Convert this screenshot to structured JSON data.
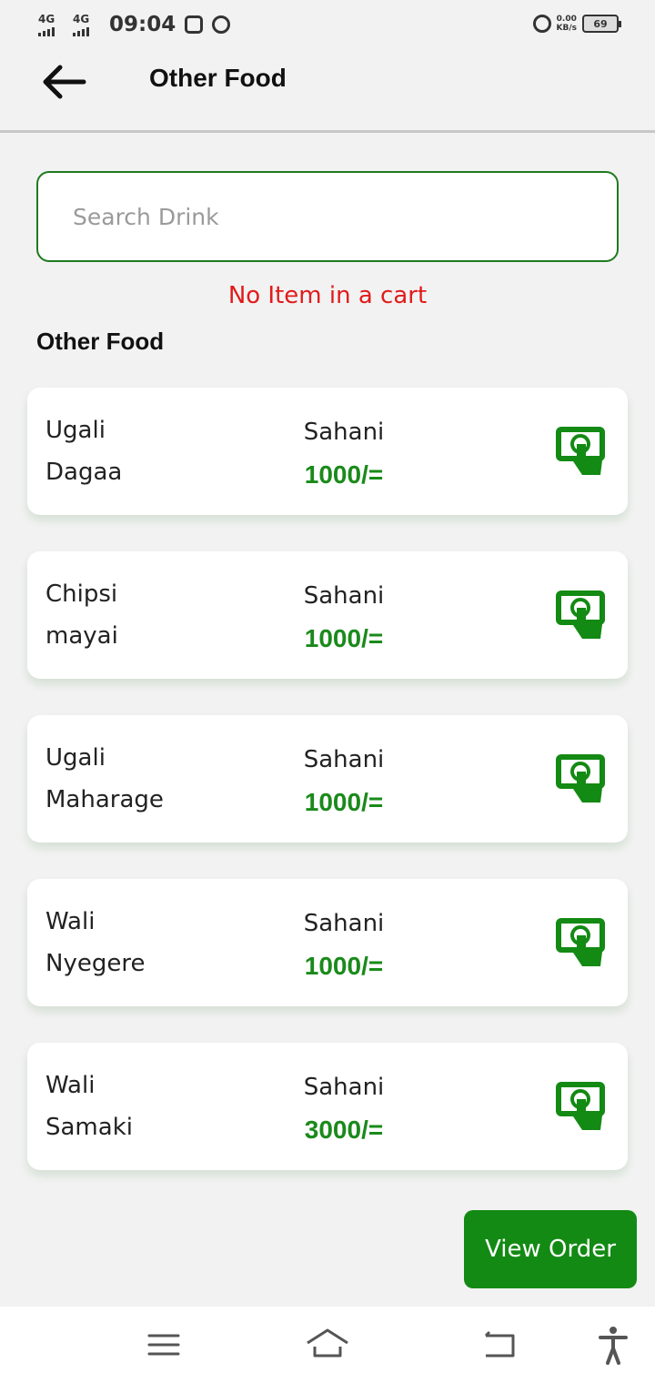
{
  "status_bar": {
    "net1": "4G",
    "net2": "4G",
    "time": "09:04",
    "speed_value": "0.00",
    "speed_unit": "KB/s",
    "battery": "69"
  },
  "app_bar": {
    "title": "Other Food",
    "back_icon": "arrow-left-icon"
  },
  "search": {
    "placeholder": "Search Drink",
    "value": ""
  },
  "cart_message": "No Item in a cart",
  "section_title": "Other Food",
  "items": [
    {
      "name_line1": "Ugali",
      "name_line2": "Dagaa",
      "unit": "Sahani",
      "price": "1000/="
    },
    {
      "name_line1": "Chipsi",
      "name_line2": "mayai",
      "unit": "Sahani",
      "price": "1000/="
    },
    {
      "name_line1": "Ugali",
      "name_line2": "Maharage",
      "unit": "Sahani",
      "price": "1000/="
    },
    {
      "name_line1": "Wali",
      "name_line2": "Nyegere",
      "unit": "Sahani",
      "price": "1000/="
    },
    {
      "name_line1": "Wali",
      "name_line2": "Samaki",
      "unit": "Sahani",
      "price": "3000/="
    }
  ],
  "view_order_label": "View Order",
  "colors": {
    "accent_green": "#138a13",
    "price_green": "#1a8a1a",
    "error_red": "#e11b1b",
    "search_border": "#1f7a1f"
  },
  "icons": {
    "add_to_cart": "touch-screen-tap-icon",
    "nav": [
      "menu-icon",
      "home-icon",
      "back-icon",
      "accessibility-icon"
    ]
  }
}
